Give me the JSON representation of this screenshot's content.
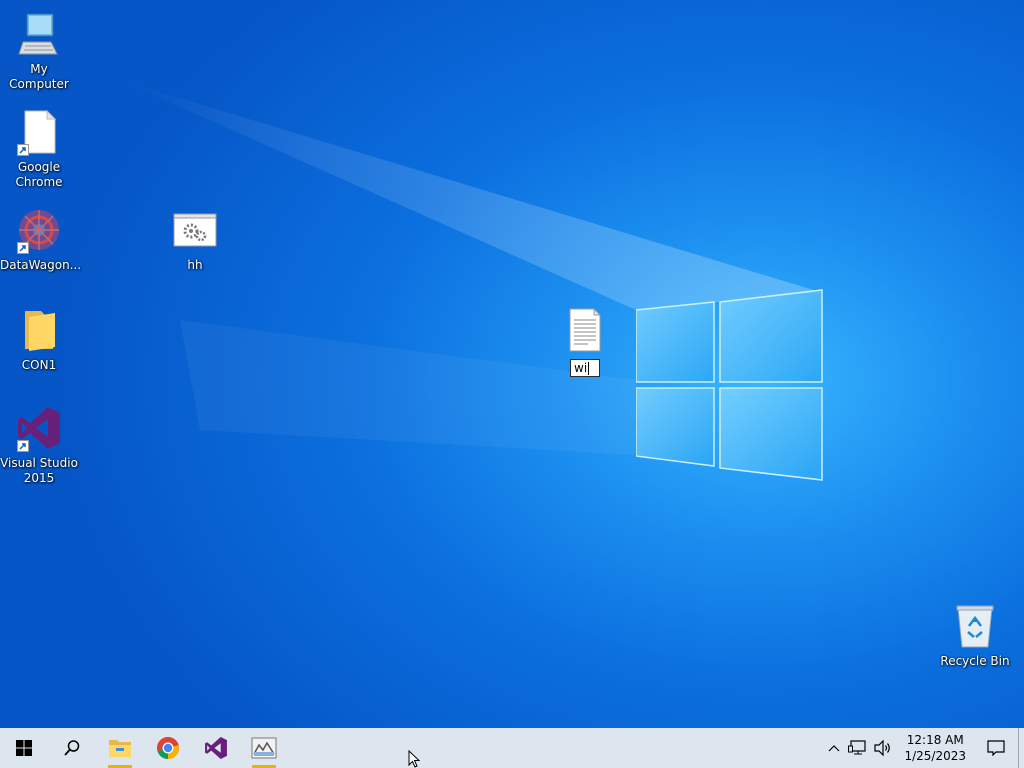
{
  "desktop": {
    "icons": [
      {
        "label": "My Computer"
      },
      {
        "label": "Google Chrome"
      },
      {
        "label": "DataWagon..."
      },
      {
        "label": "hh"
      },
      {
        "label": "CON1"
      },
      {
        "label": "Visual Studio 2015"
      },
      {
        "label": "Recycle Bin"
      }
    ],
    "rename_file": {
      "value": "wi"
    }
  },
  "taskbar": {
    "start_icon": "windows-start-icon",
    "search_icon": "search-icon",
    "pinned": [
      "file-explorer-icon",
      "chrome-icon",
      "visual-studio-icon",
      "datawagon-icon"
    ],
    "tray": {
      "time": "12:18 AM",
      "date": "1/25/2023"
    }
  },
  "colors": {
    "taskbar_bg": "#dde6ef",
    "desktop_accent": "#0b6fde",
    "pinned_indicator": "#e8b600"
  }
}
